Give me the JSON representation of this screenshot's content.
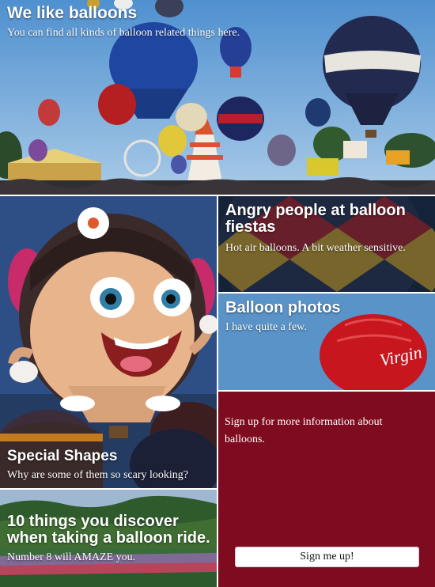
{
  "colors": {
    "signup_bg": "#7e0b1f",
    "sky": "#5b9bd2",
    "button_bg": "#ffffff"
  },
  "hero": {
    "title": "We like balloons",
    "subtitle": "You can find all kinds of balloon related things here.",
    "image": "hot-air-balloons-festival"
  },
  "tiles": {
    "shapes": {
      "title": "Special Shapes",
      "subtitle": "Why are some of them so scary looking?",
      "image": "girl-shaped-balloon"
    },
    "things": {
      "title": "10 things you discover when taking a balloon ride.",
      "subtitle": "Number 8 will AMAZE you.",
      "image": "aerial-landscape"
    },
    "angry": {
      "title": "Angry people at balloon fiestas",
      "subtitle": "Hot air balloons. A bit weather sensitive.",
      "image": "balloon-envelope"
    },
    "photos": {
      "title": "Balloon photos",
      "subtitle": "I have quite a few.",
      "image": "red-virgin-balloon",
      "balloon_text": "Virgin"
    }
  },
  "signup": {
    "text": "Sign up for more information about balloons.",
    "button_label": "Sign me up!"
  }
}
